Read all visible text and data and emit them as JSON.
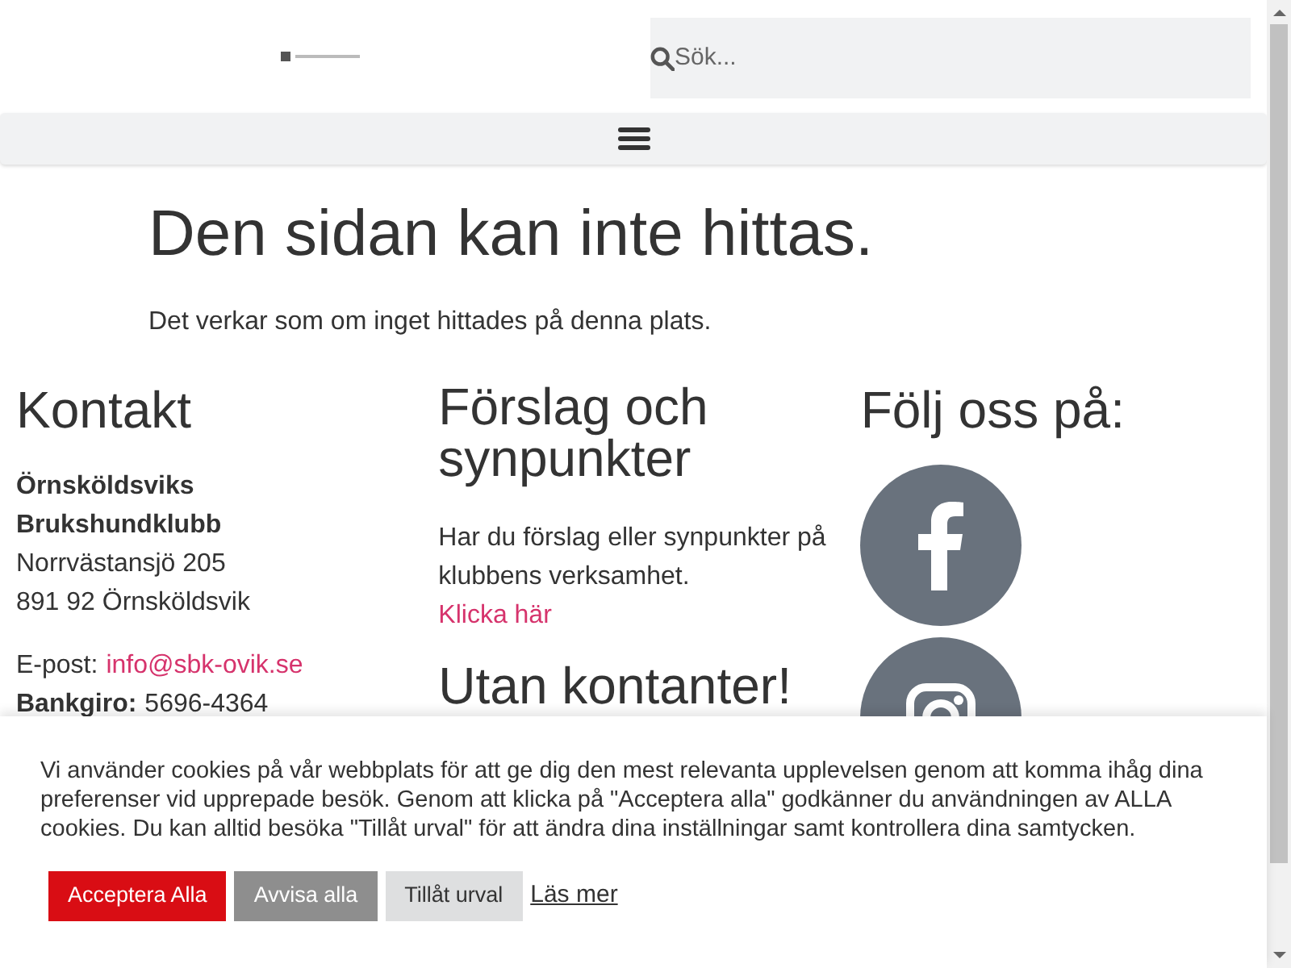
{
  "header": {
    "search": {
      "placeholder": "Sök..."
    }
  },
  "not_found": {
    "title": "Den sidan kan inte hittas.",
    "message": "Det verkar som om inget hittades på denna plats."
  },
  "contact": {
    "title": "Kontakt",
    "org_lines": [
      "Örnsköldsviks",
      "Brukshundklubb"
    ],
    "address_lines": [
      "Norrvästansjö 205",
      "891 92 Örnsköldsvik"
    ],
    "email_label": "E-post:",
    "email": "info@sbk-ovik.se",
    "bankgiro_label": "Bankgiro:",
    "bankgiro": "5696-4364"
  },
  "suggestions": {
    "title": "Förslag och synpunkter",
    "text": "Har du förslag eller synpunkter på klubbens verksamhet.",
    "link": "Klicka här",
    "next_title": "Utan kontanter!"
  },
  "social": {
    "title": "Följ oss på:",
    "links": [
      {
        "kind": "facebook"
      },
      {
        "kind": "instagram"
      }
    ]
  },
  "cookie_banner": {
    "text": "Vi använder cookies på vår webbplats för att ge dig den mest relevanta upplevelsen genom att komma ihåg dina preferenser vid upprepade besök. Genom att klicka på \"Acceptera alla\" godkänner du användningen av ALLA cookies. Du kan alltid besöka \"Tillåt urval\" för att ändra dina inställningar samt kontrollera dina samtycken.",
    "buttons": [
      {
        "kind": "accept",
        "label": "Acceptera Alla"
      },
      {
        "kind": "reject",
        "label": "Avvisa alla"
      },
      {
        "kind": "settings",
        "label": "Tillåt urval"
      },
      {
        "kind": "link",
        "label": "Läs mer"
      }
    ]
  }
}
